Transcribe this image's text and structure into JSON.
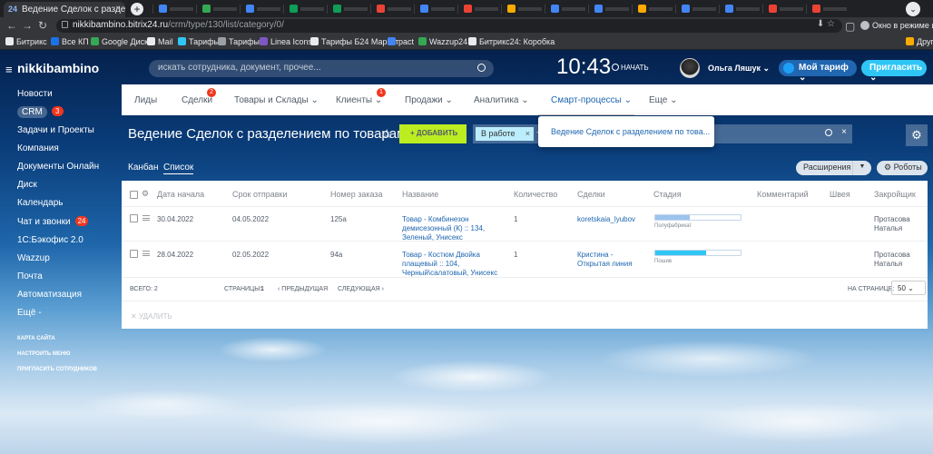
{
  "browser": {
    "active_tab": "Ведение Сделок с разделением",
    "active_tab_favicon": "24",
    "url_host": "nikkibambino.bitrix24.ru",
    "url_path": "/crm/type/130/list/category/0/",
    "incognito_label": "Окно в режиме инко",
    "bookmarks": [
      "Битрикс",
      "Все КП",
      "Google Диск",
      "Mail",
      "Тарифы",
      "Тарифы",
      "Linea Icons",
      "Тарифы Б24 Маркет",
      "pact",
      "Wazzup24",
      "Битрикс24: Коробка",
      "Друг"
    ],
    "bookmark_colors": [
      "#e8eaed",
      "#1a73e8",
      "#34a853",
      "#e8eaed",
      "#2fc6f6",
      "#9aa0a6",
      "#7e57c2",
      "#e8eaed",
      "#4285f4",
      "#34a853",
      "#e8eaed",
      "#f9ab00"
    ]
  },
  "header": {
    "logo": "nikkibambino",
    "search_placeholder": "искать сотрудника, документ, прочее...",
    "time": "10:43",
    "start_label": "НАЧАТЬ",
    "user_name": "Ольга Ляшук",
    "tariff_label": "Мой тариф",
    "invite_label": "Пригласить"
  },
  "leftmenu": {
    "items": [
      "Новости",
      "CRM",
      "Задачи и Проекты",
      "Компания",
      "Документы Онлайн",
      "Диск",
      "Календарь",
      "Чат и звонки",
      "1С:Бэкофис 2.0",
      "Wazzup",
      "Почта",
      "Автоматизация",
      "Ещё -"
    ],
    "crm_badge": "3",
    "chat_badge": "24",
    "links": [
      "КАРТА САЙТА",
      "НАСТРОИТЬ МЕНЮ",
      "ПРИГЛАСИТЬ СОТРУДНИКОВ"
    ]
  },
  "topnav": {
    "items": [
      "Лиды",
      "Сделки",
      "Товары и Склады",
      "Клиенты",
      "Продажи",
      "Аналитика",
      "Смарт-процессы",
      "Еще"
    ],
    "deals_badge": "2",
    "clients_badge": "1"
  },
  "popup": {
    "item": "Ведение Сделок с разделением по товa..."
  },
  "page": {
    "title": "Ведение Сделок с разделением по товарам",
    "add_button": "ДОБАВИТЬ",
    "filter_chip": "В работе",
    "views": [
      "Канбан",
      "Список"
    ],
    "extensions_label": "Расширения",
    "robots_label": "Роботы"
  },
  "grid": {
    "columns": [
      "Дата начала",
      "Срок отправки",
      "Номер заказа",
      "Название",
      "Количество",
      "Сделки",
      "Стадия",
      "Комментарий",
      "Швея",
      "Закройщик"
    ],
    "rows": [
      {
        "start": "30.04.2022",
        "due": "04.05.2022",
        "order": "125a",
        "name": [
          "Товар - Комбинезон",
          "демисезонный (К) :: 134,",
          "Зеленый, Унисекс"
        ],
        "qty": "1",
        "deal": [
          "koretskaia_lyubov"
        ],
        "stage": "Полуфабрикат",
        "stage_progress": 0.4,
        "stage_color": "#9dc3ee",
        "cutter": [
          "Протасова",
          "Наталья"
        ]
      },
      {
        "start": "28.04.2022",
        "due": "02.05.2022",
        "order": "94a",
        "name": [
          "Товар - Костюм Двойка",
          "плащевый :: 104,",
          "Черный\\салатовый, Унисекс"
        ],
        "qty": "1",
        "deal": [
          "Кристина -",
          "Открытая линия"
        ],
        "stage": "Пошив",
        "stage_progress": 0.6,
        "stage_color": "#2fc6f6",
        "cutter": [
          "Протасова",
          "Наталья"
        ]
      }
    ],
    "footer": {
      "total": "ВСЕГО: 2",
      "pages_label": "СТРАНИЦЫ:",
      "page": "1",
      "prev": "ПРЕДЫДУЩАЯ",
      "next": "СЛЕДУЮЩАЯ",
      "per_page_label": "НА СТРАНИЦЕ:",
      "per_page": "50"
    },
    "delete_label": "УДАЛИТЬ"
  }
}
